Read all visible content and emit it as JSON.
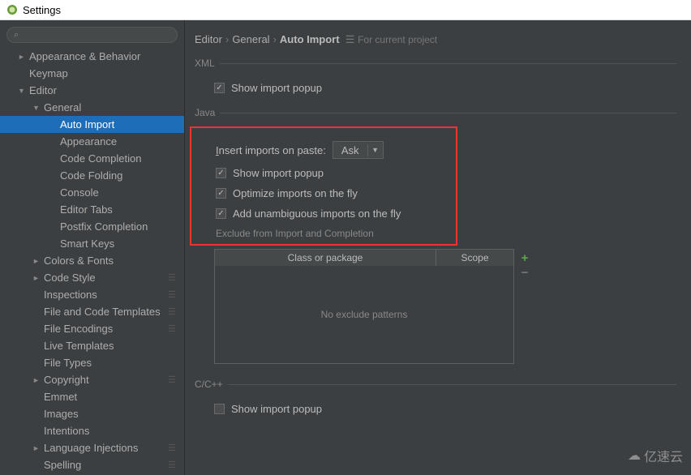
{
  "window": {
    "title": "Settings"
  },
  "search": {
    "placeholder": ""
  },
  "sidebar": [
    {
      "label": "Appearance & Behavior",
      "level": 1,
      "arrow": "►"
    },
    {
      "label": "Keymap",
      "level": 1,
      "arrow": ""
    },
    {
      "label": "Editor",
      "level": 1,
      "arrow": "▼"
    },
    {
      "label": "General",
      "level": 2,
      "arrow": "▼"
    },
    {
      "label": "Auto Import",
      "level": 3,
      "arrow": "",
      "selected": true
    },
    {
      "label": "Appearance",
      "level": 3,
      "arrow": ""
    },
    {
      "label": "Code Completion",
      "level": 3,
      "arrow": ""
    },
    {
      "label": "Code Folding",
      "level": 3,
      "arrow": ""
    },
    {
      "label": "Console",
      "level": 3,
      "arrow": ""
    },
    {
      "label": "Editor Tabs",
      "level": 3,
      "arrow": ""
    },
    {
      "label": "Postfix Completion",
      "level": 3,
      "arrow": ""
    },
    {
      "label": "Smart Keys",
      "level": 3,
      "arrow": ""
    },
    {
      "label": "Colors & Fonts",
      "level": 2,
      "arrow": "►"
    },
    {
      "label": "Code Style",
      "level": 2,
      "arrow": "►",
      "cfg": true
    },
    {
      "label": "Inspections",
      "level": 2,
      "arrow": "",
      "cfg": true
    },
    {
      "label": "File and Code Templates",
      "level": 2,
      "arrow": "",
      "cfg": true
    },
    {
      "label": "File Encodings",
      "level": 2,
      "arrow": "",
      "cfg": true
    },
    {
      "label": "Live Templates",
      "level": 2,
      "arrow": ""
    },
    {
      "label": "File Types",
      "level": 2,
      "arrow": ""
    },
    {
      "label": "Copyright",
      "level": 2,
      "arrow": "►",
      "cfg": true
    },
    {
      "label": "Emmet",
      "level": 2,
      "arrow": ""
    },
    {
      "label": "Images",
      "level": 2,
      "arrow": ""
    },
    {
      "label": "Intentions",
      "level": 2,
      "arrow": ""
    },
    {
      "label": "Language Injections",
      "level": 2,
      "arrow": "►",
      "cfg": true
    },
    {
      "label": "Spelling",
      "level": 2,
      "arrow": "",
      "cfg": true
    }
  ],
  "breadcrumb": {
    "a": "Editor",
    "b": "General",
    "c": "Auto Import",
    "ctx": "For current project"
  },
  "xml": {
    "legend": "XML",
    "show_import_popup": "Show import popup",
    "show_import_popup_checked": true
  },
  "java": {
    "legend": "Java",
    "insert_label": "Insert imports on paste:",
    "insert_value": "Ask",
    "show_import_popup": "Show import popup",
    "show_import_popup_checked": true,
    "optimize": "Optimize imports on the fly",
    "optimize_checked": true,
    "unambiguous": "Add unambiguous imports on the fly",
    "unambiguous_checked": true,
    "exclude_label": "Exclude from Import and Completion",
    "table": {
      "class_header": "Class or package",
      "scope_header": "Scope",
      "empty_text": "No exclude patterns"
    }
  },
  "cpp": {
    "legend": "C/C++",
    "show_import_popup": "Show import popup",
    "show_import_popup_checked": false
  },
  "watermark": "亿速云"
}
